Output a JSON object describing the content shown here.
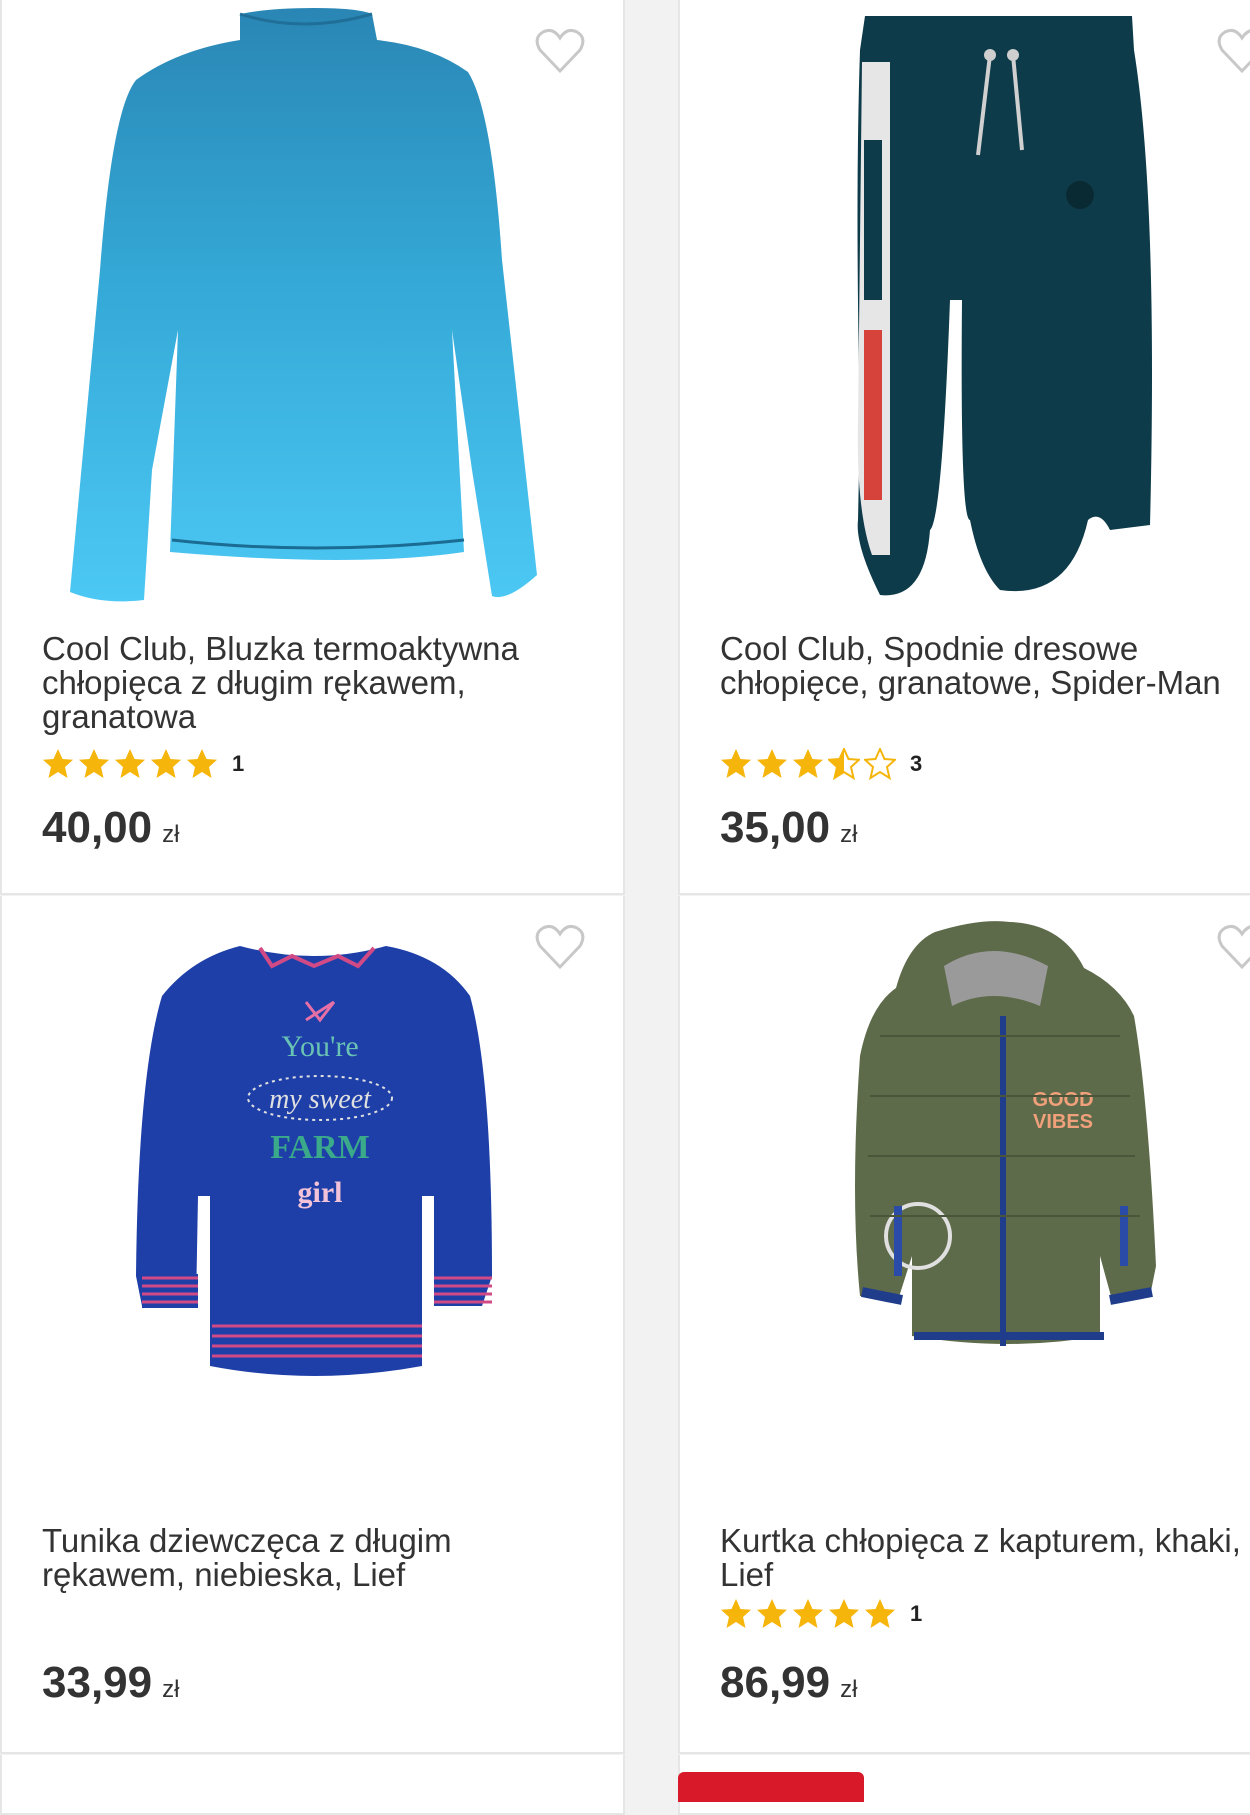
{
  "products": [
    {
      "title": "Cool Club, Bluzka termoaktywna\nchłopięca z długim rękawem,\ngranatowa",
      "rating_stars": 5,
      "rating_count": "1",
      "price": "40,00",
      "currency": "zł",
      "image": "blue-gradient-long-sleeve-top"
    },
    {
      "title": "Cool Club, Spodnie dresowe\nchłopięce, granatowe, Spider-Man",
      "rating_stars": 3.5,
      "rating_count": "3",
      "price": "35,00",
      "currency": "zł",
      "image": "navy-spider-man-sweatpants"
    },
    {
      "title": "Tunika dziewczęca z długim\nrękawem, niebieska, Lief",
      "rating_stars": 0,
      "rating_count": "",
      "price": "33,99",
      "currency": "zł",
      "image": "blue-farm-girl-tunic",
      "print_text": [
        "You're",
        "my sweet",
        "FARM",
        "girl"
      ]
    },
    {
      "title": "Kurtka chłopięca z kapturem, khaki,\nLief",
      "rating_stars": 5,
      "rating_count": "1",
      "price": "86,99",
      "currency": "zł",
      "image": "khaki-quilted-hooded-jacket",
      "print_text": [
        "GOOD",
        "VIBES"
      ]
    }
  ],
  "colors": {
    "star": "#f5b50a",
    "star_empty": "#f5b50a",
    "heart": "#c8c8c8",
    "text": "#333333",
    "accent": "#d7192a"
  }
}
